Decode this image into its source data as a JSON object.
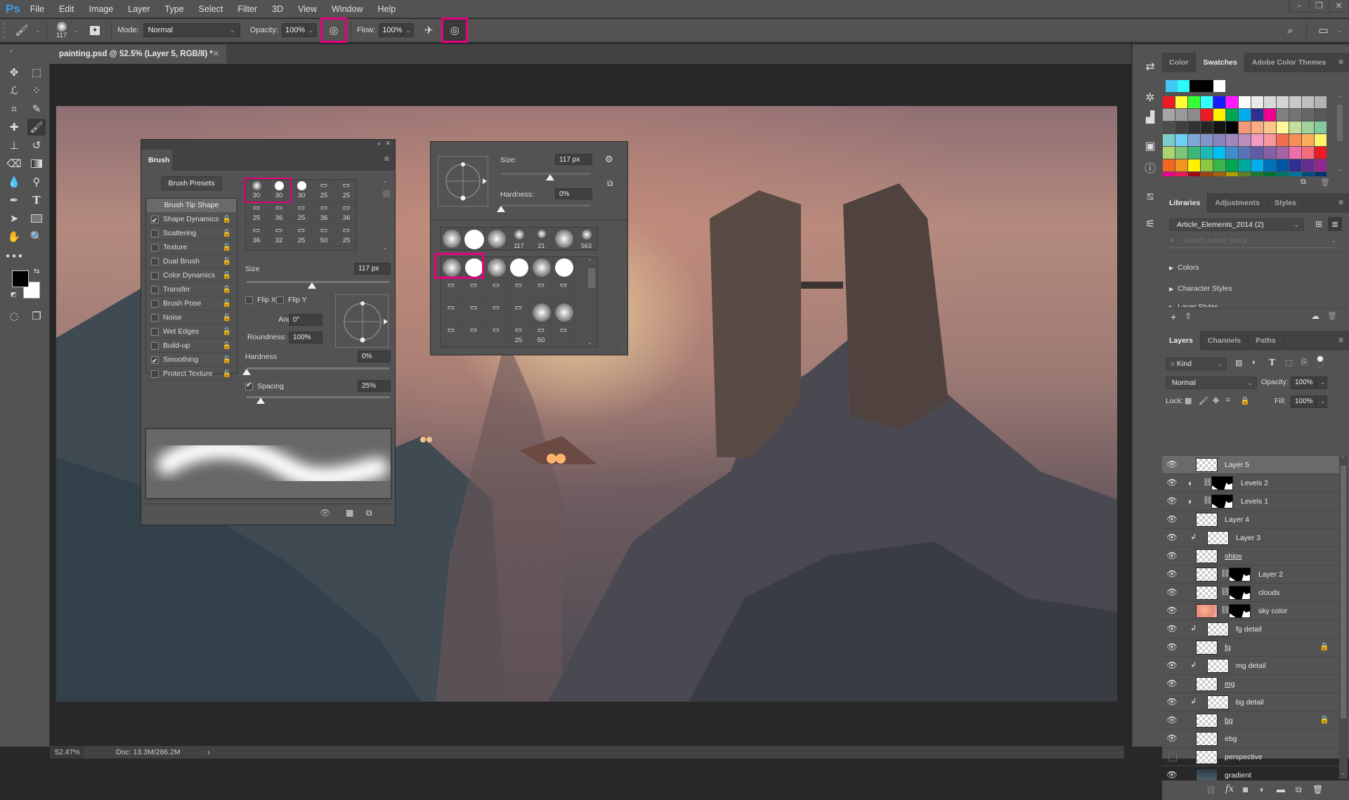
{
  "app": {
    "logo": "Ps"
  },
  "menu": [
    "File",
    "Edit",
    "Image",
    "Layer",
    "Type",
    "Select",
    "Filter",
    "3D",
    "View",
    "Window",
    "Help"
  ],
  "window_controls": {
    "minimize": "–",
    "restore": "❐",
    "close": "✕"
  },
  "options_bar": {
    "brush_size": "117",
    "mode_label": "Mode:",
    "mode_value": "Normal",
    "opacity_label": "Opacity:",
    "opacity_value": "100%",
    "flow_label": "Flow:",
    "flow_value": "100%",
    "highlight_color": "#e6007e"
  },
  "document_tab": {
    "title": "painting.psd @ 52.5% (Layer 5, RGB/8) *",
    "close": "✕"
  },
  "status_bar": {
    "zoom": "52.47%",
    "doc": "Doc: 13.3M/286.2M",
    "arrow": "›"
  },
  "tools": [
    "move",
    "marquee",
    "lasso",
    "quick-selection",
    "crop",
    "eyedropper",
    "healing",
    "brush",
    "stamp",
    "history-brush",
    "eraser",
    "gradient",
    "blur",
    "dodge",
    "pen",
    "type",
    "path-selection",
    "rectangle",
    "hand",
    "zoom",
    "more"
  ],
  "brush_panel": {
    "title": "Brush",
    "presets_button": "Brush Presets",
    "tip_shape": "Brush Tip Shape",
    "options": [
      {
        "label": "Shape Dynamics",
        "checked": true
      },
      {
        "label": "Scattering",
        "checked": false
      },
      {
        "label": "Texture",
        "checked": false
      },
      {
        "label": "Dual Brush",
        "checked": false
      },
      {
        "label": "Color Dynamics",
        "checked": false
      },
      {
        "label": "Transfer",
        "checked": false
      },
      {
        "label": "Brush Pose",
        "checked": false
      },
      {
        "label": "Noise",
        "checked": false
      },
      {
        "label": "Wet Edges",
        "checked": false
      },
      {
        "label": "Build-up",
        "checked": false
      },
      {
        "label": "Smoothing",
        "checked": true
      },
      {
        "label": "Protect Texture",
        "checked": false
      }
    ],
    "tips": [
      [
        "30",
        "30",
        "30",
        "25",
        "25"
      ],
      [
        "25",
        "36",
        "25",
        "36",
        "36"
      ],
      [
        "36",
        "32",
        "25",
        "50",
        "25"
      ]
    ],
    "size_label": "Size",
    "size_value": "117 px",
    "size_fraction": 0.46,
    "flip_x": "Flip X",
    "flip_y": "Flip Y",
    "angle_label": "Angle:",
    "angle_value": "0°",
    "roundness_label": "Roundness:",
    "roundness_value": "100%",
    "hardness_label": "Hardness",
    "hardness_value": "0%",
    "hardness_fraction": 0.0,
    "spacing_label": "Spacing",
    "spacing_value": "25%",
    "spacing_checked": true,
    "spacing_fraction": 0.1
  },
  "preset_picker": {
    "size_label": "Size:",
    "size_value": "117 px",
    "size_fraction": 0.55,
    "hardness_label": "Hardness:",
    "hardness_value": "0%",
    "hardness_fraction": 0.0,
    "recent_labels": [
      "",
      "",
      "",
      "117",
      "21",
      "",
      "563"
    ],
    "grid_labels": [
      "",
      "",
      "",
      "25",
      "50",
      ""
    ]
  },
  "swatches_panel": {
    "tabs": [
      "Color",
      "Swatches",
      "Adobe Color Themes"
    ],
    "active_tab": "Swatches",
    "recent": [
      "#3fc8f4",
      "#2ef9f9",
      "#000000",
      "#000000",
      "#ffffff"
    ],
    "grid": [
      [
        "#ed1c24",
        "#ffff33",
        "#33ff33",
        "#33ffff",
        "#1a1aff",
        "#ff1aff",
        "#ffffff",
        "#ebebeb",
        "#d9d9d9",
        "#d4d4d4",
        "#c8c8c8",
        "#bfbfbf",
        "#b3b3b3"
      ],
      [
        "#a6a6a6",
        "#999999",
        "#8c8c8c",
        "#ed1c24",
        "#fff200",
        "#00a651",
        "#00aeef",
        "#2e3192",
        "#ec008c",
        "#7f7f7f",
        "#737373",
        "#666666",
        "#595959"
      ],
      [
        "#4d4d4d",
        "#404040",
        "#333333",
        "#262626",
        "#131313",
        "#000000",
        "#f7977a",
        "#f9ad81",
        "#fdc68a",
        "#fff79a",
        "#c4df9b",
        "#a3d39c",
        "#82ca9d"
      ],
      [
        "#7bcdc8",
        "#6ecff6",
        "#7ea7d8",
        "#8493ca",
        "#8882be",
        "#a187be",
        "#bc8dbf",
        "#f49ac2",
        "#f6989d",
        "#f26c4f",
        "#f68e55",
        "#fbaf5d",
        "#fff568"
      ],
      [
        "#acd372",
        "#7cc576",
        "#3bb878",
        "#1abbb4",
        "#00bff3",
        "#438ccb",
        "#5574b9",
        "#605ca8",
        "#855fa8",
        "#a763a8",
        "#f06eaa",
        "#f26d7d",
        "#ed1c24"
      ],
      [
        "#f26522",
        "#f7941d",
        "#fff200",
        "#8dc73f",
        "#39b54a",
        "#00a651",
        "#00a99d",
        "#00aeef",
        "#0072bc",
        "#0054a6",
        "#2e3192",
        "#662d91",
        "#92278f"
      ],
      [
        "#ec008c",
        "#ed145b",
        "#9e0b0f",
        "#a0410d",
        "#a36209",
        "#aba000",
        "#598527",
        "#1a7b30",
        "#007236",
        "#00746b",
        "#0076a3",
        "#004b80",
        "#003471"
      ]
    ]
  },
  "libraries_panel": {
    "tabs": [
      "Libraries",
      "Adjustments",
      "Styles"
    ],
    "active_tab": "Libraries",
    "library": "Article_Elements_2014 (2)",
    "search_placeholder": "Search Adobe Stock",
    "sections": [
      "Colors",
      "Character Styles",
      "Layer Styles"
    ]
  },
  "layers_panel": {
    "tabs": [
      "Layers",
      "Channels",
      "Paths"
    ],
    "active_tab": "Layers",
    "filter": "Kind",
    "blend_mode": "Normal",
    "opacity_label": "Opacity:",
    "opacity_value": "100%",
    "lock_label": "Lock:",
    "fill_label": "Fill:",
    "fill_value": "100%",
    "layers": [
      {
        "name": "Layer 5",
        "visible": true,
        "selected": true,
        "type": "pixel"
      },
      {
        "name": "Levels 2",
        "visible": true,
        "type": "adjustment",
        "mask": true
      },
      {
        "name": "Levels 1",
        "visible": true,
        "type": "adjustment",
        "mask": true
      },
      {
        "name": "Layer 4",
        "visible": true,
        "type": "pixel"
      },
      {
        "name": "Layer 3",
        "visible": true,
        "type": "pixel",
        "clipped": true
      },
      {
        "name": "ships",
        "visible": true,
        "type": "pixel",
        "underline": true
      },
      {
        "name": "Layer 2",
        "visible": true,
        "type": "pixel",
        "mask": true
      },
      {
        "name": "clouds",
        "visible": true,
        "type": "pixel",
        "mask": true
      },
      {
        "name": "sky color",
        "visible": true,
        "type": "pixel",
        "mask": true
      },
      {
        "name": "fg detail",
        "visible": true,
        "type": "pixel",
        "clipped": true
      },
      {
        "name": "fg",
        "visible": true,
        "type": "pixel",
        "underline": true,
        "locked": true
      },
      {
        "name": "mg detail",
        "visible": true,
        "type": "pixel",
        "clipped": true
      },
      {
        "name": "mg",
        "visible": true,
        "type": "pixel",
        "underline": true
      },
      {
        "name": "bg detail",
        "visible": true,
        "type": "pixel",
        "clipped": true
      },
      {
        "name": "bg",
        "visible": true,
        "type": "pixel",
        "underline": true,
        "locked": true
      },
      {
        "name": "ebg",
        "visible": true,
        "type": "pixel"
      },
      {
        "name": "perspective",
        "visible": false,
        "type": "pixel"
      },
      {
        "name": "gradient",
        "visible": true,
        "type": "pixel"
      }
    ]
  }
}
